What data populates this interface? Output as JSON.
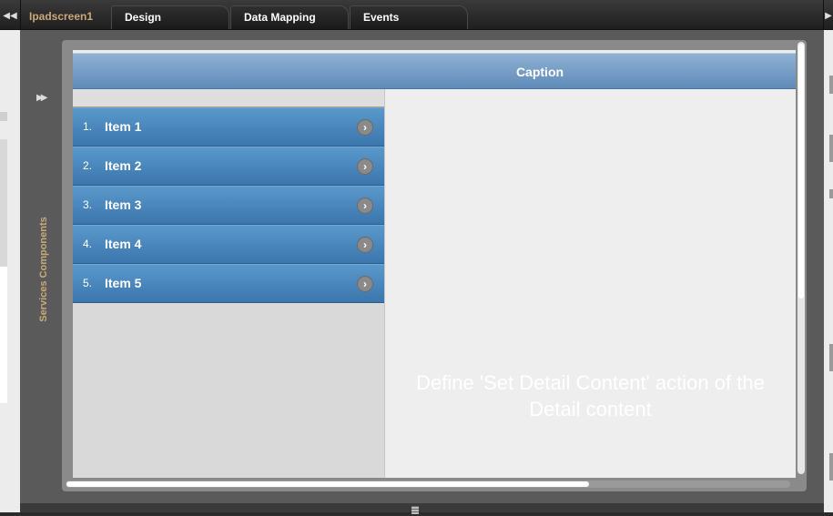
{
  "tabs": {
    "screen_name": "Ipadscreen1",
    "items": [
      "Design",
      "Data Mapping",
      "Events"
    ]
  },
  "sidebar": {
    "label": "Services Components",
    "toggle_icon": "double-chevron-right-icon"
  },
  "device": {
    "caption": "Caption",
    "list": [
      {
        "num": "1.",
        "label": "Item 1"
      },
      {
        "num": "2.",
        "label": "Item 2"
      },
      {
        "num": "3.",
        "label": "Item 3"
      },
      {
        "num": "4.",
        "label": "Item 4"
      },
      {
        "num": "5.",
        "label": "Item 5"
      }
    ],
    "detail_line1": "Define 'Set Detail Content' action of the",
    "detail_line2": "Detail content"
  },
  "colors": {
    "list_item": "#4a87bd",
    "caption_bar": "#79a0c8",
    "accent_label": "#c9a97a"
  }
}
